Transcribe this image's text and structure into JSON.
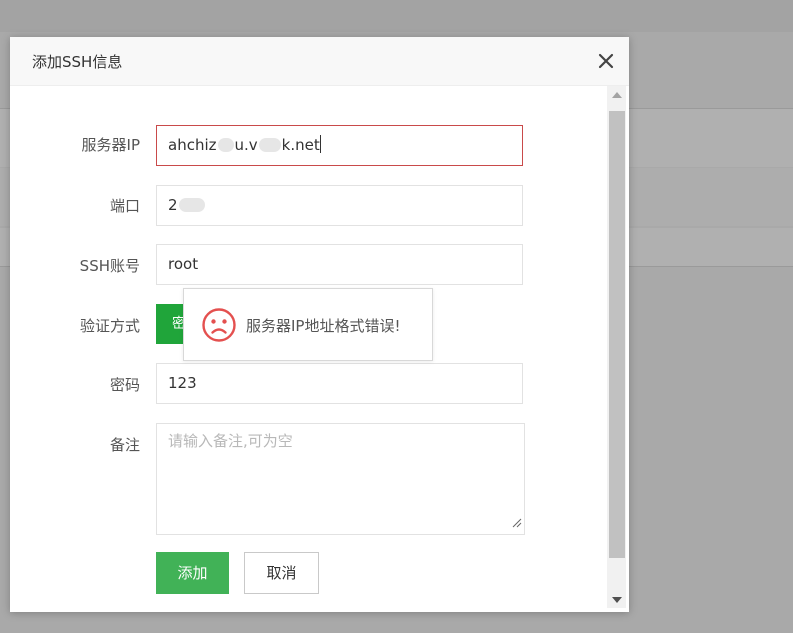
{
  "dialog": {
    "title": "添加SSH信息",
    "close_icon": "close-icon"
  },
  "form": {
    "server_ip": {
      "label": "服务器IP",
      "value_prefix": "ahchiz",
      "value_mid": "u.v",
      "value_suffix": "k.net"
    },
    "port": {
      "label": "端口",
      "value_prefix": "2"
    },
    "ssh_account": {
      "label": "SSH账号",
      "value": "root"
    },
    "auth_method": {
      "label": "验证方式",
      "selected": "密"
    },
    "password": {
      "label": "密码",
      "value": "123"
    },
    "remark": {
      "label": "备注",
      "placeholder": "请输入备注,可为空"
    }
  },
  "buttons": {
    "add": "添加",
    "cancel": "取消"
  },
  "toast": {
    "message": "服务器IP地址格式错误!",
    "icon": "sad-face-icon"
  },
  "colors": {
    "primary": "#20a53a",
    "error_border": "#c94a4a",
    "error_icon": "#e4504f"
  }
}
